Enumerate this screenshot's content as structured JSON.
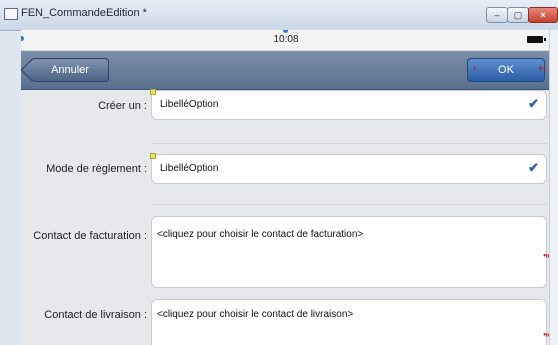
{
  "window": {
    "title": "FEN_CommandeEdition *",
    "controls": [
      "–",
      "▢",
      "×"
    ]
  },
  "statusbar": {
    "time": "10:08"
  },
  "navbar": {
    "back_label": "Annuler",
    "ok_label": "OK"
  },
  "rows": [
    {
      "label": "Créer un :",
      "value": "LibelléOption",
      "type": "combo"
    },
    {
      "label": "Mode de règlement :",
      "value": "LibelléOption",
      "type": "combo"
    },
    {
      "label": "Contact de facturation :",
      "value": "<cliquez pour choisir le contact de facturation>",
      "type": "picker"
    },
    {
      "label": "Contact de livraison :",
      "value": "<cliquez pour choisir le contact de livraison>",
      "type": "picker"
    }
  ],
  "icons": {
    "combo": "checkmark-icon",
    "window": "window-icon"
  },
  "colors": {
    "ok_button": "#2c5ea6",
    "navbar": "#58708f",
    "check": "#2b5fb0",
    "marker": "#c41a1a"
  }
}
